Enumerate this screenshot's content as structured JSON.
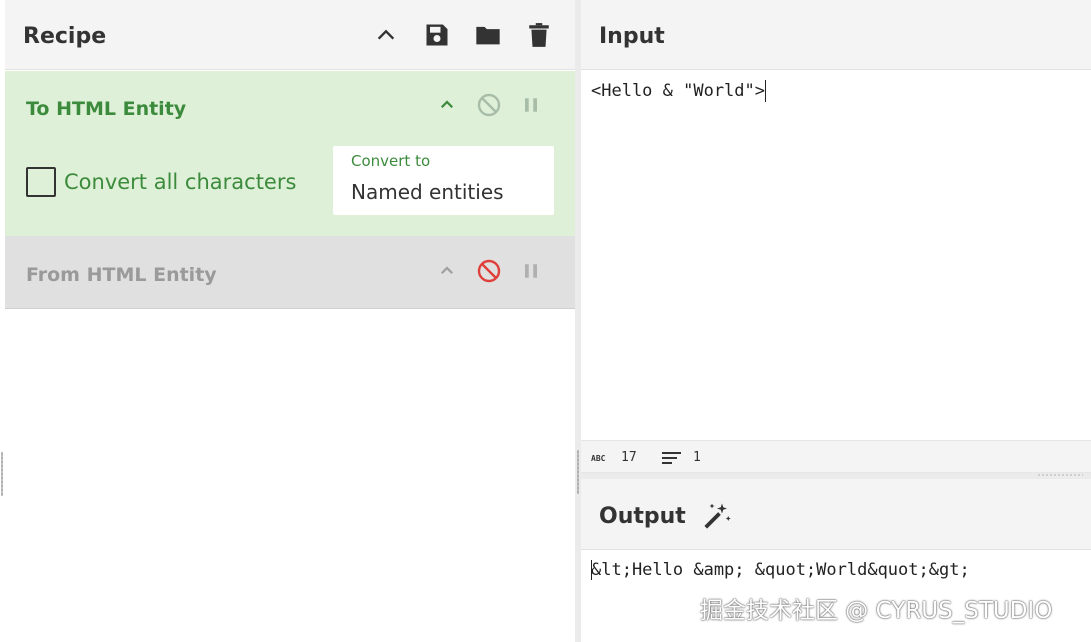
{
  "recipe": {
    "title": "Recipe",
    "header_icons": [
      "chevron-up-icon",
      "save-icon",
      "folder-icon",
      "trash-icon"
    ],
    "operations": [
      {
        "name": "To HTML Entity",
        "state": "enabled",
        "checkbox_label": "Convert all characters",
        "checkbox_checked": false,
        "select_caption": "Convert to",
        "select_value": "Named entities",
        "accent_color": "#3c8b3c",
        "background": "#dff0d8"
      },
      {
        "name": "From HTML Entity",
        "state": "disabled",
        "background": "#e0e0e0",
        "disable_icon_color": "#e0403a"
      }
    ]
  },
  "input": {
    "title": "Input",
    "text": "<Hello & \"World\">",
    "status": {
      "length": "17",
      "lines": "1"
    }
  },
  "output": {
    "title": "Output",
    "text": "&lt;Hello &amp; &quot;World&quot;&gt;"
  },
  "watermark": "掘金技术社区 @ CYRUS_STUDIO"
}
